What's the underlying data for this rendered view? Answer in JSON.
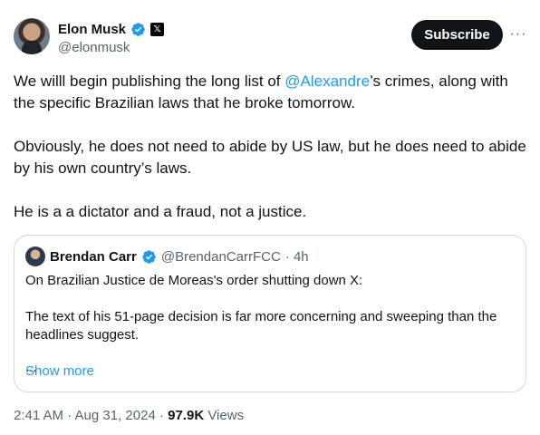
{
  "author": {
    "name": "Elon Musk",
    "handle": "@elonmusk",
    "verified_icon": "verified-badge-icon",
    "affiliate_icon": "x-logo-icon"
  },
  "actions": {
    "subscribe_label": "Subscribe",
    "more_label": "···"
  },
  "post": {
    "p1_before": "We willl begin publishing the long list of ",
    "p1_mention": "@Alexandre",
    "p1_after": "’s crimes, along with the specific Brazilian laws that he broke tomorrow.",
    "p2": "Obviously, he does not need to abide by US law, but he does need to abide by his own country’s laws.",
    "p3": "He is a a dictator and a fraud, not a justice."
  },
  "quote": {
    "name": "Brendan Carr",
    "handle": "@BrendanCarrFCC",
    "time": "· 4h",
    "line1": "On Brazilian Justice de Moreas's order shutting down X:",
    "line2": "The text of his 51-page decision is far more concerning and sweeping than the headlines suggest.",
    "line3": "...",
    "show_more": "Show more"
  },
  "meta": {
    "timestamp": "2:41 AM · Aug 31, 2024 · ",
    "views_count": "97.9K",
    "views_label": " Views"
  },
  "colors": {
    "link": "#1d9bf0",
    "text": "#0f1419",
    "secondary": "#536471",
    "border": "#cfd9de"
  }
}
